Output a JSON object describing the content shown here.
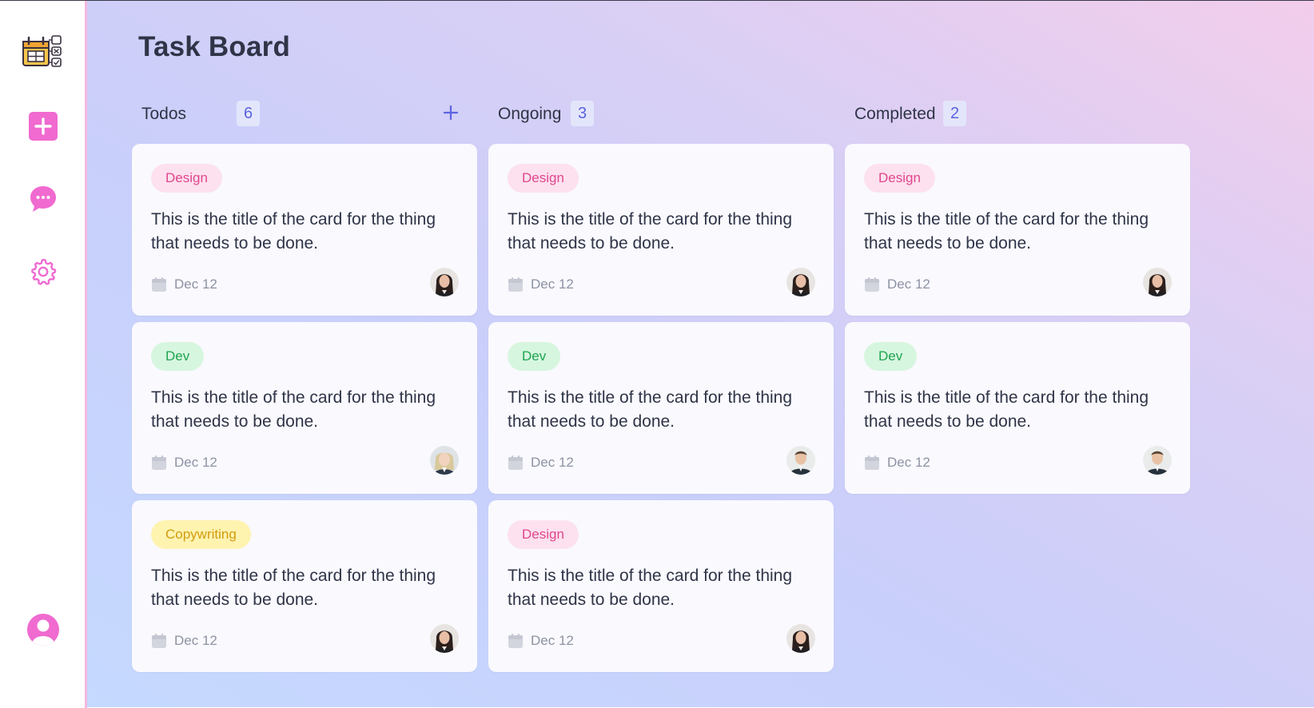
{
  "app": {
    "title": "Task Board"
  },
  "sidebar": {
    "logo_icon": "kanban-calendar-logo",
    "items": [
      {
        "name": "add-task-button",
        "icon": "plus-square-icon"
      },
      {
        "name": "messages-button",
        "icon": "chat-bubble-icon"
      },
      {
        "name": "settings-button",
        "icon": "gear-icon"
      }
    ],
    "profile_icon": "user-circle-icon"
  },
  "colors": {
    "accent": "#f06ad0",
    "count_text": "#5b63e0",
    "count_bg": "#e3e6fb",
    "design_tag_text": "#e0468f",
    "design_tag_bg": "#fde1ee",
    "dev_tag_text": "#1fa451",
    "dev_tag_bg": "#d7f6df",
    "copy_tag_text": "#d29c0e",
    "copy_tag_bg": "#fff3b0"
  },
  "columns": [
    {
      "name": "Todos",
      "count": "6",
      "has_add": true,
      "cards": [
        {
          "tag": "Design",
          "tag_type": "design",
          "title": "This is the title of the card for the thing that needs to be done.",
          "date": "Dec 12",
          "avatar": "woman-dark-hair"
        },
        {
          "tag": "Dev",
          "tag_type": "dev",
          "title": "This is the title of the card for the thing that needs to be done.",
          "date": "Dec 12",
          "avatar": "woman-blonde"
        },
        {
          "tag": "Copywriting",
          "tag_type": "copy",
          "title": "This is the title of the card for the thing that needs to be done.",
          "date": "Dec 12",
          "avatar": "woman-dark-hair"
        }
      ]
    },
    {
      "name": "Ongoing",
      "count": "3",
      "has_add": false,
      "cards": [
        {
          "tag": "Design",
          "tag_type": "design",
          "title": "This is the title of the card for the thing that needs to be done.",
          "date": "Dec 12",
          "avatar": "woman-dark-hair"
        },
        {
          "tag": "Dev",
          "tag_type": "dev",
          "title": "This is the title of the card for the thing that needs to be done.",
          "date": "Dec 12",
          "avatar": "man-light"
        },
        {
          "tag": "Design",
          "tag_type": "design",
          "title": "This is the title of the card for the thing that needs to be done.",
          "date": "Dec 12",
          "avatar": "woman-dark-hair"
        }
      ]
    },
    {
      "name": "Completed",
      "count": "2",
      "has_add": false,
      "cards": [
        {
          "tag": "Design",
          "tag_type": "design",
          "title": "This is the title of the card for the thing that needs to be done.",
          "date": "Dec 12",
          "avatar": "woman-dark-hair"
        },
        {
          "tag": "Dev",
          "tag_type": "dev",
          "title": "This is the title of the card for the thing that needs to be done.",
          "date": "Dec 12",
          "avatar": "man-light"
        }
      ]
    }
  ]
}
